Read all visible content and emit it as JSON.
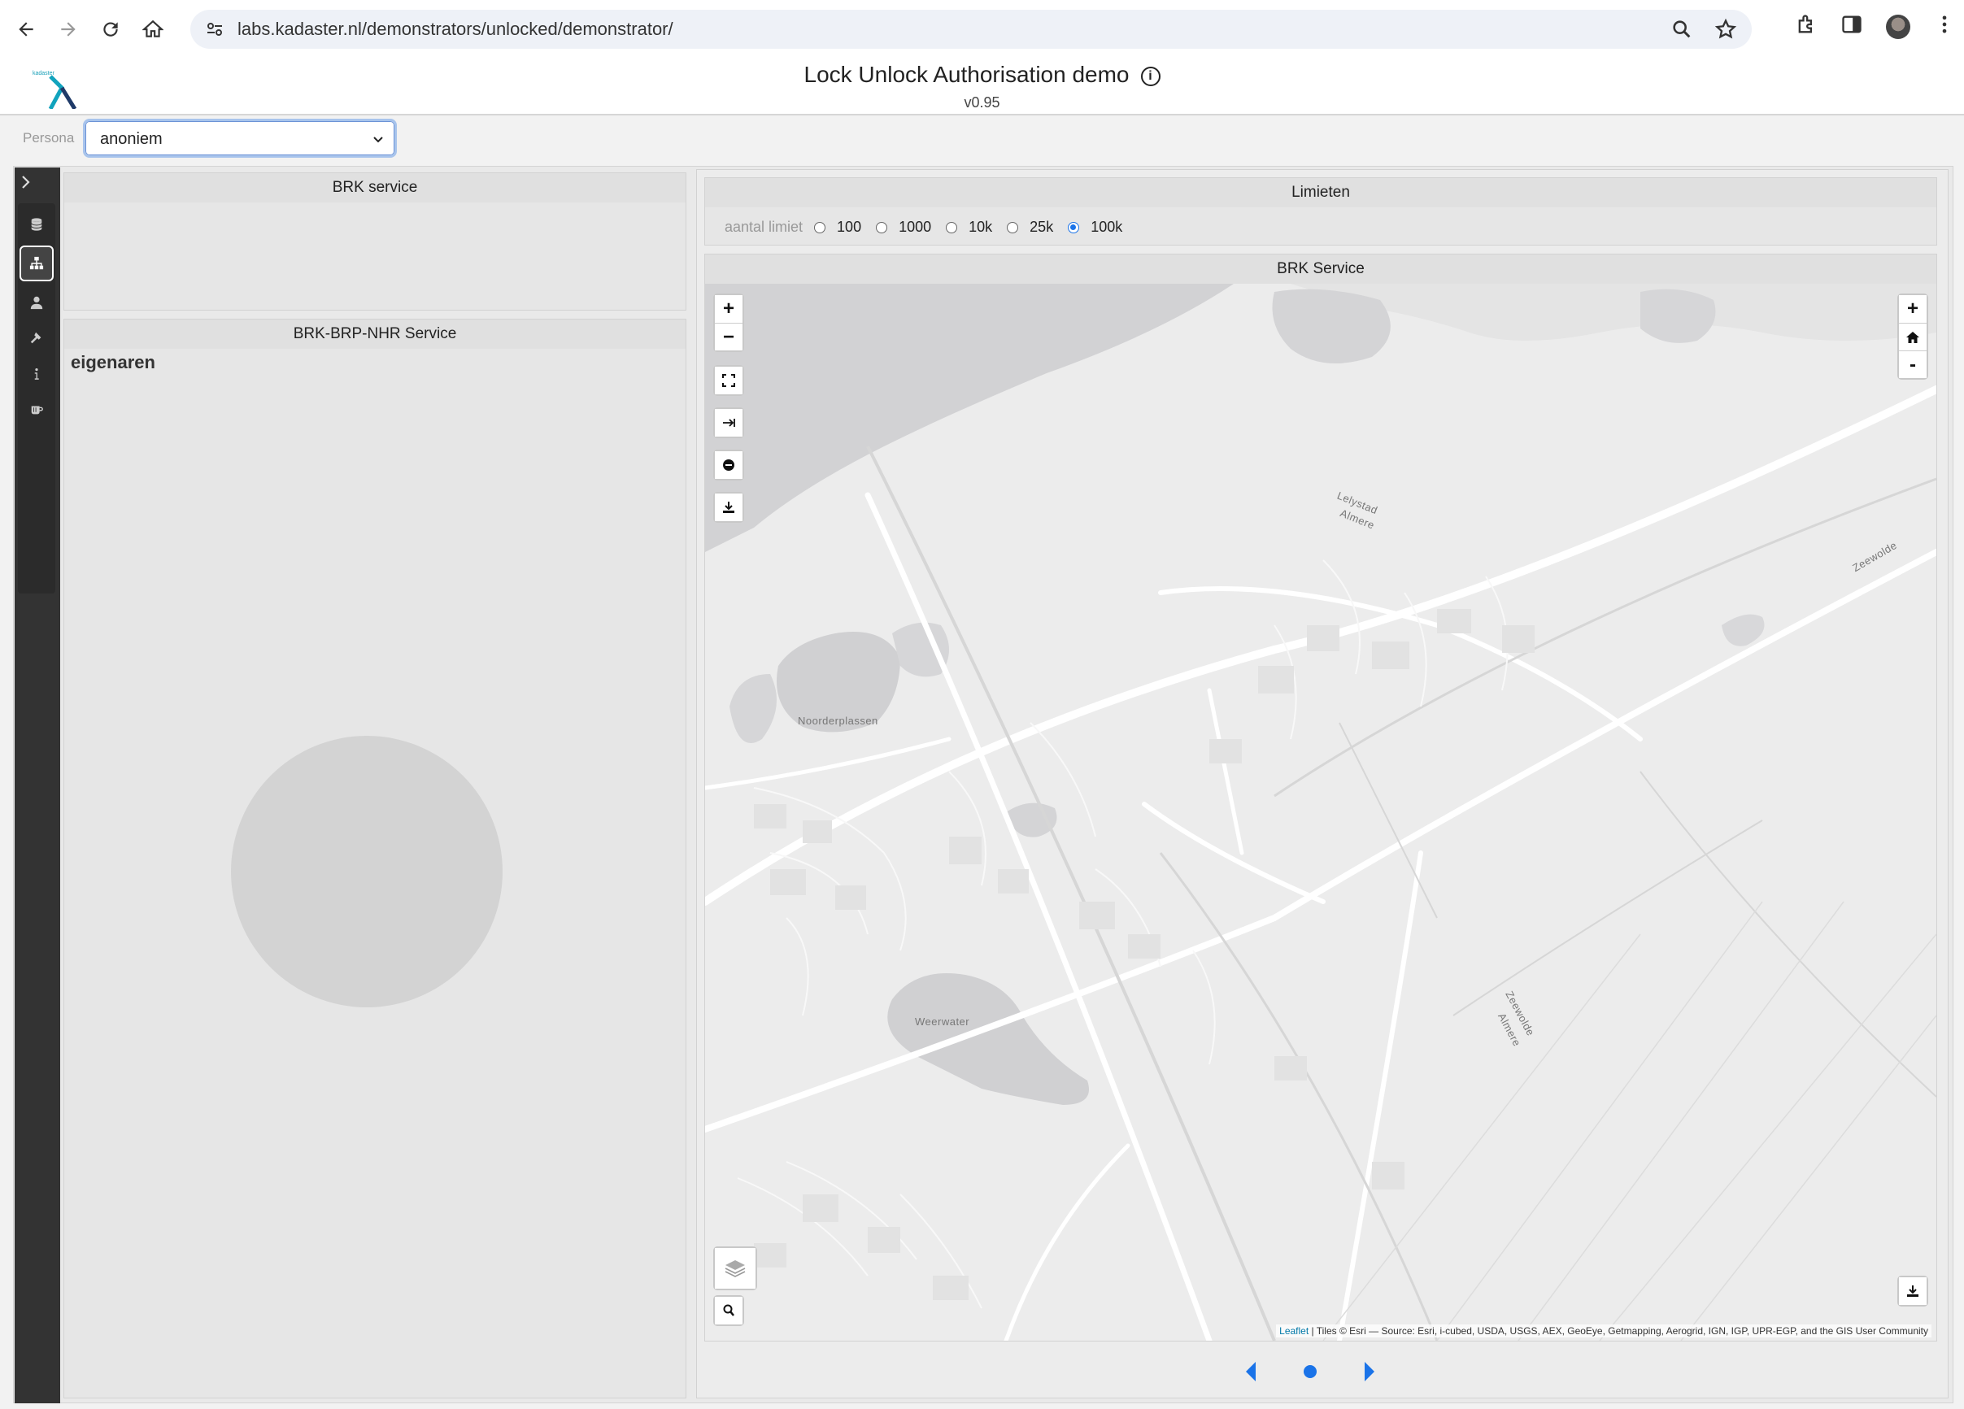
{
  "browser": {
    "url": "labs.kadaster.nl/demonstrators/unlocked/demonstrator/",
    "icons": [
      "back-icon",
      "forward-icon",
      "reload-icon",
      "home-icon",
      "site-settings-icon",
      "zoom-icon",
      "bookmark-star-icon",
      "extensions-icon",
      "side-panel-icon",
      "avatar",
      "menu-dots-icon"
    ]
  },
  "app": {
    "logo_text": "kadaster",
    "title": "Lock Unlock Authorisation demo",
    "version": "v0.95"
  },
  "persona": {
    "label": "Persona",
    "selected": "anoniem"
  },
  "sidebar": {
    "items": [
      "database-icon",
      "sitemap-icon",
      "user-icon",
      "hammer-icon",
      "info-icon",
      "coffee-icon"
    ]
  },
  "panels": {
    "brk_service": {
      "title": "BRK service"
    },
    "brk_brp_nhr": {
      "title": "BRK-BRP-NHR Service",
      "heading": "eigenaren"
    },
    "limieten": {
      "title": "Limieten",
      "label": "aantal limiet",
      "options": [
        "100",
        "1000",
        "10k",
        "25k",
        "100k"
      ],
      "selected": "100k"
    },
    "map": {
      "title": "BRK Service",
      "labels": {
        "noorderplassen": "Noorderplassen",
        "weerwater": "Weerwater",
        "zeewolde_top": "Zeewolde",
        "zeewolde_road": "Zeewolde",
        "almere_road": "Almere",
        "lelystad_road": "Lelystad",
        "almere_top": "Almere"
      },
      "attribution_link": "Leaflet",
      "attribution_text": " | Tiles © Esri — Source: Esri, i-cubed, USDA, USGS, AEX, GeoEye, Getmapping, Aerogrid, IGN, IGP, UPR-EGP, and the GIS User Community"
    }
  }
}
